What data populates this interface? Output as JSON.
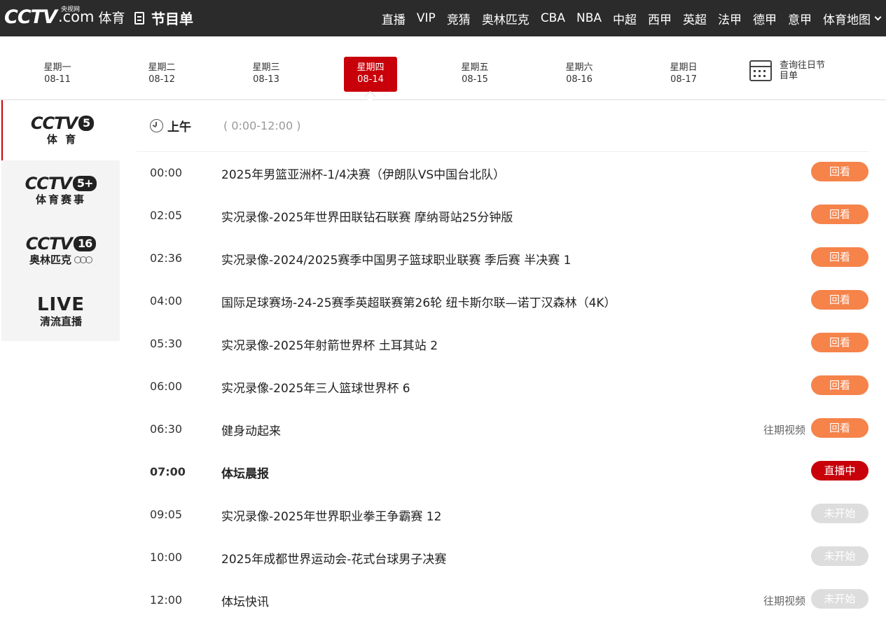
{
  "header": {
    "logo": "CCTV",
    "logo_dot": ".com",
    "logo_small": "央视网",
    "logo_sub": "体育",
    "schedule_label": "节目单",
    "nav": [
      "直播",
      "VIP",
      "竞猜",
      "奥林匹克",
      "CBA",
      "NBA",
      "中超",
      "西甲",
      "英超",
      "法甲",
      "德甲",
      "意甲"
    ],
    "nav_last": "体育地图"
  },
  "dates": [
    {
      "weekday": "星期一",
      "date": "08-11"
    },
    {
      "weekday": "星期二",
      "date": "08-12"
    },
    {
      "weekday": "星期三",
      "date": "08-13"
    },
    {
      "weekday": "星期四",
      "date": "08-14"
    },
    {
      "weekday": "星期五",
      "date": "08-15"
    },
    {
      "weekday": "星期六",
      "date": "08-16"
    },
    {
      "weekday": "星期日",
      "date": "08-17"
    }
  ],
  "active_date_index": 3,
  "history_label": "查询往日节目单",
  "channels": [
    {
      "brand": "CCTV",
      "num": "5",
      "sub": "体 育"
    },
    {
      "brand": "CCTV",
      "num": "5+",
      "sub": "体育赛事"
    },
    {
      "brand": "CCTV",
      "num": "16",
      "sub": "奥林匹克"
    },
    {
      "brand": "LIVE",
      "num": "",
      "sub": "清流直播"
    }
  ],
  "period": {
    "label": "上午",
    "range": "( 0:00-12:00 )"
  },
  "programs": [
    {
      "time": "00:00",
      "title": "2025年男篮亚洲杯-1/4决赛（伊朗队VS中国台北队）",
      "past": "",
      "status": "回看"
    },
    {
      "time": "02:05",
      "title": "实况录像-2025年世界田联钻石联赛 摩纳哥站25分钟版",
      "past": "",
      "status": "回看"
    },
    {
      "time": "02:36",
      "title": "实况录像-2024/2025赛季中国男子篮球职业联赛 季后赛  半决赛 1",
      "past": "",
      "status": "回看"
    },
    {
      "time": "04:00",
      "title": "国际足球赛场-24-25赛季英超联赛第26轮 纽卡斯尔联—诺丁汉森林（4K）",
      "past": "",
      "status": "回看"
    },
    {
      "time": "05:30",
      "title": "实况录像-2025年射箭世界杯 土耳其站 2",
      "past": "",
      "status": "回看"
    },
    {
      "time": "06:00",
      "title": "实况录像-2025年三人篮球世界杯 6",
      "past": "",
      "status": "回看"
    },
    {
      "time": "06:30",
      "title": "健身动起来",
      "past": "往期视频",
      "status": "回看"
    },
    {
      "time": "07:00",
      "title": "体坛晨报",
      "past": "",
      "status": "直播中"
    },
    {
      "time": "09:05",
      "title": "实况录像-2025年世界职业拳王争霸赛 12",
      "past": "",
      "status": "未开始"
    },
    {
      "time": "10:00",
      "title": "2025年成都世界运动会-花式台球男子决赛",
      "past": "",
      "status": "未开始"
    },
    {
      "time": "12:00",
      "title": "体坛快讯",
      "past": "往期视频",
      "status": "未开始"
    }
  ],
  "colors": {
    "accent": "#c8000a",
    "replay": "#f5834a",
    "pending": "#dddddd",
    "topbar": "#2b2b2b"
  }
}
